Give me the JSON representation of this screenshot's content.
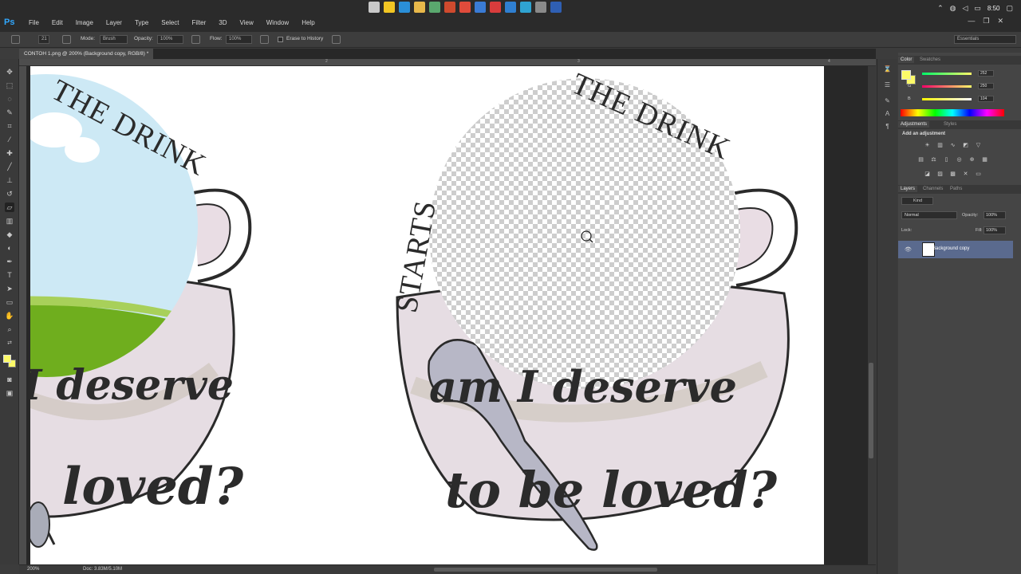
{
  "app": {
    "logo": "Ps",
    "document_tab": "CONTOH 1.png @ 200% (Background copy, RGB/8) *"
  },
  "menu": [
    "File",
    "Edit",
    "Image",
    "Layer",
    "Type",
    "Select",
    "Filter",
    "3D",
    "View",
    "Window",
    "Help"
  ],
  "system": {
    "time": "8:50",
    "tray_icons": [
      "chevron-up-icon",
      "network-icon",
      "volume-icon",
      "keyboard-icon",
      "notification-icon"
    ]
  },
  "taskbar_colors": [
    "#c9c9c9",
    "#f2c623",
    "#2a8fd8",
    "#e8b84a",
    "#5aa86e",
    "#d04a2e",
    "#e04b3b",
    "#3a7bd5",
    "#d93c3c",
    "#2f7fd1",
    "#2fa3d1",
    "#8a8a8a",
    "#2f5fb3"
  ],
  "options": {
    "mode_label": "Mode:",
    "mode_value": "Brush",
    "opacity_label": "Opacity:",
    "opacity_value": "100%",
    "flow_label": "Flow:",
    "flow_value": "100%",
    "erase_history_label": "Erase to History",
    "brush_size": "21",
    "workspace": "Essentials"
  },
  "rulers": {
    "h_labels": [
      "2",
      "3",
      "4"
    ]
  },
  "artwork": {
    "left": {
      "arc_text": "THE DRINK",
      "line1": "I deserve",
      "line2": "loved?"
    },
    "right": {
      "arc_text": "THE DRINK",
      "side_text": "STARTS",
      "line1": "am I deserve",
      "line2": "to be loved?"
    }
  },
  "status": {
    "zoom": "200%",
    "doc": "Doc: 3.83M/5.10M"
  },
  "color_panel": {
    "tabs": [
      "Color",
      "Swatches"
    ],
    "fg": "#fcfa68",
    "r": "252",
    "g": "250",
    "b": "104",
    "labels": [
      "R",
      "G",
      "B"
    ]
  },
  "adjustments": {
    "tabs": [
      "Adjustments",
      "Styles"
    ],
    "heading": "Add an adjustment"
  },
  "layers_panel": {
    "tabs": [
      "Layers",
      "Channels",
      "Paths"
    ],
    "kind_label": "Kind",
    "blend_mode": "Normal",
    "opacity_label": "Opacity:",
    "opacity_value": "100%",
    "lock_label": "Lock:",
    "fill_label": "Fill:",
    "fill_value": "100%",
    "layer_name": "Background copy"
  }
}
